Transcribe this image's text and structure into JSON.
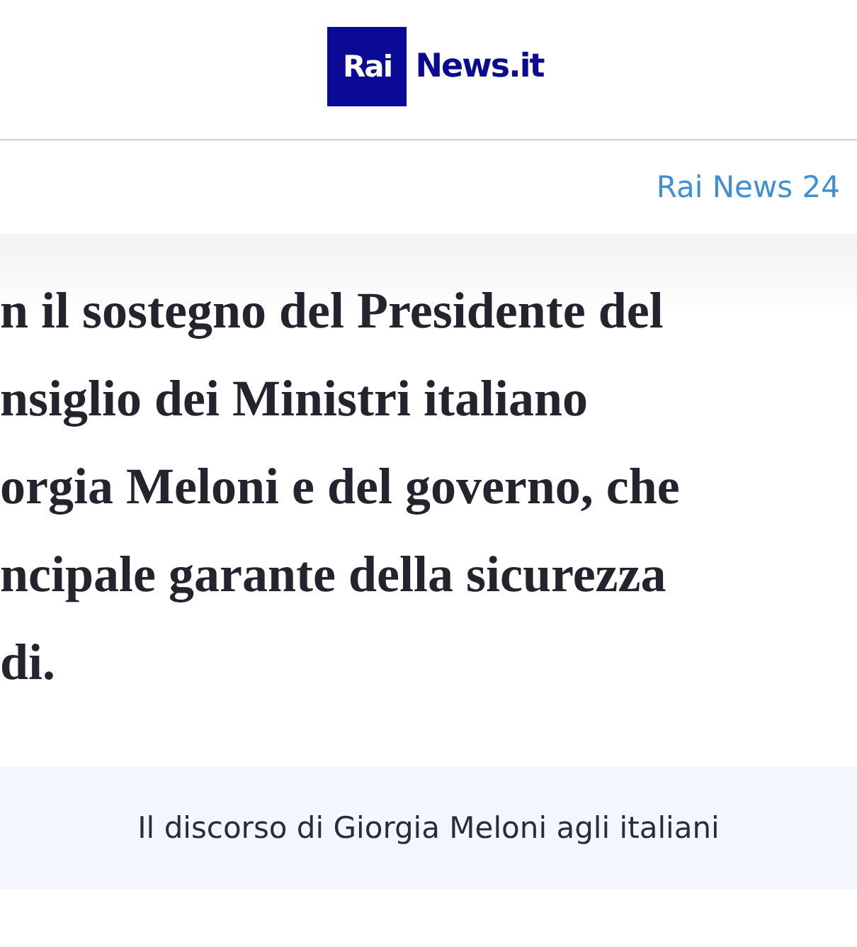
{
  "header": {
    "logo": {
      "badge": "Rai",
      "wordmark": "News.it"
    }
  },
  "source_link": "Rai News 24",
  "quote": {
    "lines": [
      "n il sostegno del Presidente del",
      "nsiglio dei Ministri italiano",
      "orgia Meloni e del governo, che",
      "ncipale garante della sicurezza",
      "di."
    ]
  },
  "caption": "Il discorso di Giorgia Meloni agli italiani"
}
